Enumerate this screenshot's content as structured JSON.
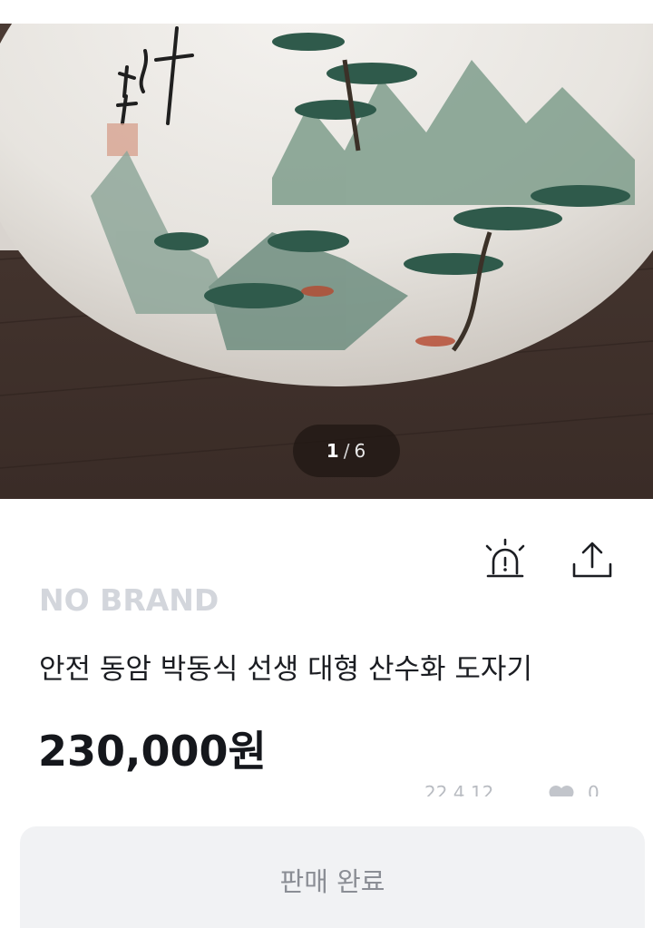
{
  "gallery": {
    "current": "1",
    "separator": "/",
    "total": "6"
  },
  "product": {
    "brand": "NO BRAND",
    "title": "안전 동암 박동식 선생 대형 산수화 도자기",
    "price": "230,000원",
    "date": "22.4.12",
    "likes": "0"
  },
  "actions": {
    "report_icon": "alarm-siren-icon",
    "share_icon": "share-upload-icon",
    "sold_label": "판매 완료"
  },
  "colors": {
    "brand_text": "#d3d6dc",
    "title_text": "#1b1d22",
    "price_text": "#15171c",
    "sold_bg": "#f1f2f4",
    "sold_text": "#8b8e95"
  }
}
